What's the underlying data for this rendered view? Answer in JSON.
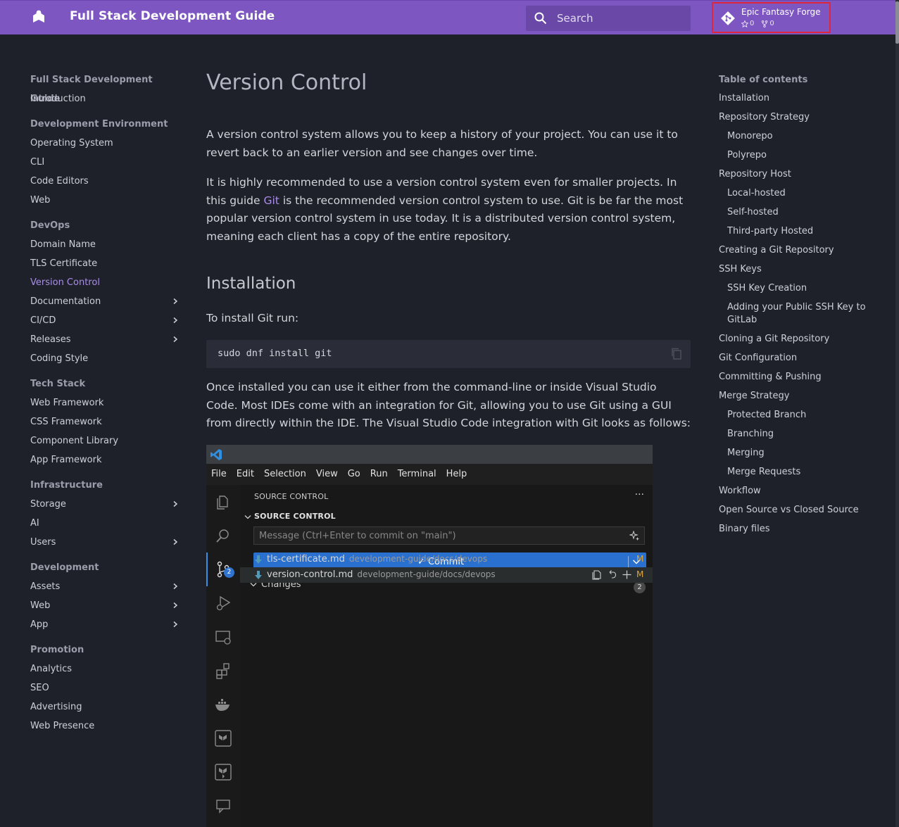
{
  "header": {
    "site_title": "Full Stack Development Guide",
    "search_placeholder": "Search",
    "repo": {
      "name": "Epic Fantasy Forge",
      "stars": "0",
      "forks": "0"
    }
  },
  "nav": {
    "groups": [
      {
        "title": "Full Stack Development Guide",
        "items": [
          {
            "label": "Introduction"
          }
        ]
      },
      {
        "title": "Development Environment",
        "items": [
          {
            "label": "Operating System"
          },
          {
            "label": "CLI"
          },
          {
            "label": "Code Editors"
          },
          {
            "label": "Web"
          }
        ]
      },
      {
        "title": "DevOps",
        "items": [
          {
            "label": "Domain Name"
          },
          {
            "label": "TLS Certificate"
          },
          {
            "label": "Version Control",
            "active": true
          },
          {
            "label": "Documentation",
            "expandable": true
          },
          {
            "label": "CI/CD",
            "expandable": true
          },
          {
            "label": "Releases",
            "expandable": true
          },
          {
            "label": "Coding Style"
          }
        ]
      },
      {
        "title": "Tech Stack",
        "items": [
          {
            "label": "Web Framework"
          },
          {
            "label": "CSS Framework"
          },
          {
            "label": "Component Library"
          },
          {
            "label": "App Framework"
          }
        ]
      },
      {
        "title": "Infrastructure",
        "items": [
          {
            "label": "Storage",
            "expandable": true
          },
          {
            "label": "AI"
          },
          {
            "label": "Users",
            "expandable": true
          }
        ]
      },
      {
        "title": "Development",
        "items": [
          {
            "label": "Assets",
            "expandable": true
          },
          {
            "label": "Web",
            "expandable": true
          },
          {
            "label": "App",
            "expandable": true
          }
        ]
      },
      {
        "title": "Promotion",
        "items": [
          {
            "label": "Analytics"
          },
          {
            "label": "SEO"
          },
          {
            "label": "Advertising"
          },
          {
            "label": "Web Presence"
          }
        ]
      }
    ]
  },
  "content": {
    "title": "Version Control",
    "intro": "A version control system allows you to keep a history of your project. You can use it to revert back to an earlier version and see changes over time.",
    "p2_before": "It is highly recommended to use a version control system even for smaller projects. In this guide ",
    "p2_link": "Git",
    "p2_after": " is the recommended version control system to use. Git is be far the most popular version control system in use today. It is a distributed version control system, meaning each client has a copy of the entire repository.",
    "installation_heading": "Installation",
    "install_text": "To install Git run:",
    "code": "sudo dnf install git",
    "p3": "Once installed you can use it either from the command-line or inside Visual Studio Code. Most IDEs come with an integration for Git, allowing you to use Git using a GUI from directly within the IDE. The Visual Studio Code integration with Git looks as follows:"
  },
  "vscode": {
    "menu": [
      "File",
      "Edit",
      "Selection",
      "View",
      "Go",
      "Run",
      "Terminal",
      "Help"
    ],
    "panel_header": "SOURCE CONTROL",
    "section": "SOURCE CONTROL",
    "message_placeholder": "Message (Ctrl+Enter to commit on \"main\")",
    "commit_label": "✓ Commit",
    "changes_label": "Changes",
    "changes_count": "2",
    "scm_badge": "2",
    "files": [
      {
        "name": "tls-certificate.md",
        "path": "development-guide/docs/devops",
        "status": "M"
      },
      {
        "name": "version-control.md",
        "path": "development-guide/docs/devops",
        "status": "M"
      }
    ]
  },
  "toc": {
    "title": "Table of contents",
    "items": [
      {
        "label": "Installation"
      },
      {
        "label": "Repository Strategy"
      },
      {
        "label": "Monorepo",
        "sub": true
      },
      {
        "label": "Polyrepo",
        "sub": true
      },
      {
        "label": "Repository Host"
      },
      {
        "label": "Local-hosted",
        "sub": true
      },
      {
        "label": "Self-hosted",
        "sub": true
      },
      {
        "label": "Third-party Hosted",
        "sub": true
      },
      {
        "label": "Creating a Git Repository"
      },
      {
        "label": "SSH Keys"
      },
      {
        "label": "SSH Key Creation",
        "sub": true
      },
      {
        "label": "Adding your Public SSH Key to GitLab",
        "sub": true,
        "two": true
      },
      {
        "label": "Cloning a Git Repository"
      },
      {
        "label": "Git Configuration"
      },
      {
        "label": "Committing & Pushing"
      },
      {
        "label": "Merge Strategy"
      },
      {
        "label": "Protected Branch",
        "sub": true
      },
      {
        "label": "Branching",
        "sub": true
      },
      {
        "label": "Merging",
        "sub": true
      },
      {
        "label": "Merge Requests",
        "sub": true
      },
      {
        "label": "Workflow"
      },
      {
        "label": "Open Source vs Closed Source"
      },
      {
        "label": "Binary files"
      }
    ]
  }
}
